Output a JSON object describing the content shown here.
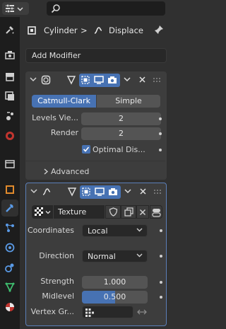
{
  "header": {
    "search_placeholder": ""
  },
  "breadcrumb": {
    "object": "Cylinder",
    "separator": ">",
    "modifier": "Displace"
  },
  "add_modifier": {
    "label": "Add Modifier"
  },
  "subsurf": {
    "mode_a": "Catmull-Clark",
    "mode_b": "Simple",
    "levels_label": "Levels Vie...",
    "levels_value": "2",
    "render_label": "Render",
    "render_value": "2",
    "optimal_label": "Optimal Dis...",
    "advanced_label": "Advanced"
  },
  "displace": {
    "texture_name": "Texture",
    "coordinates_label": "Coordinates",
    "coordinates_value": "Local",
    "direction_label": "Direction",
    "direction_value": "Normal",
    "strength_label": "Strength",
    "strength_value": "1.000",
    "midlevel_label": "Midlevel",
    "midlevel_value": "0.500",
    "midlevel_fraction": 0.5,
    "vgroup_label": "Vertex Gr..."
  },
  "colors": {
    "accent": "#4772b3",
    "active_outline": "#5b7fb8",
    "panel": "#3d3d3d",
    "bg": "#303030"
  },
  "tabs": [
    "tool-icon",
    "render-icon",
    "output-icon",
    "view-layer-icon",
    "scene-icon",
    "world-icon",
    "collection-icon",
    "object-icon",
    "modifier-icon",
    "particles-icon",
    "physics-icon",
    "constraints-icon",
    "data-icon",
    "material-icon"
  ]
}
